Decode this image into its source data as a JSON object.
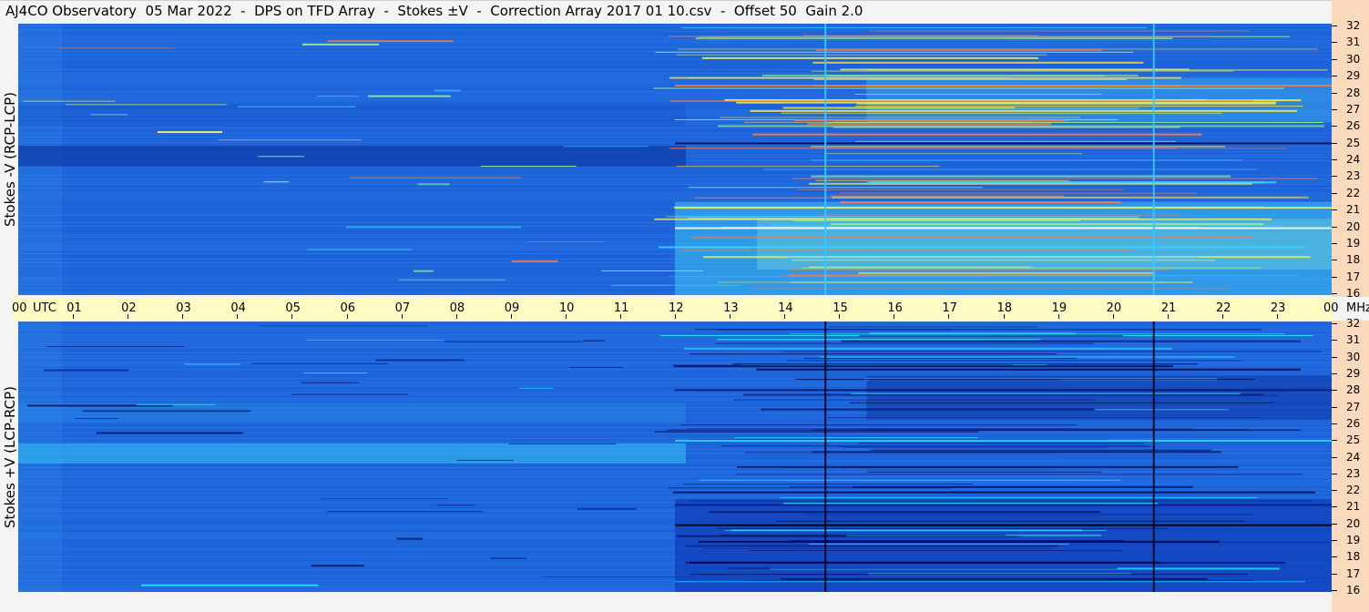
{
  "header": {
    "title": "AJ4CO Observatory  05 Mar 2022  -  DPS on TFD Array  -  Stokes ±V  -  Correction Array 2017 01 10.csv  -  Offset 50  Gain 2.0"
  },
  "chart_data": [
    {
      "type": "heatmap",
      "ylabel": "Stokes -V (RCP-LCP)",
      "xlabel": "UTC",
      "x_range_hours": [
        0,
        24
      ],
      "y_range_mhz": [
        16,
        32
      ],
      "notes": "dynamic spectrum; brighter (cyan/yellow/red) RFI and emission bands after 12 UTC, dark band near 24 MHz before 12 UTC",
      "interference_lines_utc": [
        14.75,
        20.75
      ]
    },
    {
      "type": "heatmap",
      "ylabel": "Stokes +V (LCP-RCP)",
      "xlabel": "UTC",
      "x_range_hours": [
        0,
        24
      ],
      "y_range_mhz": [
        16,
        32
      ],
      "notes": "inverse polarity; darker bands after 12 UTC, brighter band near 24 MHz before 12 UTC",
      "interference_lines_utc": [
        14.75,
        20.75
      ]
    }
  ],
  "axes": {
    "utc_labels": [
      "00",
      "UTC",
      "01",
      "02",
      "03",
      "04",
      "05",
      "06",
      "07",
      "08",
      "09",
      "10",
      "11",
      "12",
      "13",
      "14",
      "15",
      "16",
      "17",
      "18",
      "19",
      "20",
      "21",
      "22",
      "23",
      "00"
    ],
    "mhz_unit": "MHz",
    "mhz_ticks": [
      "32",
      "31",
      "30",
      "29",
      "28",
      "27",
      "26",
      "25",
      "24",
      "23",
      "22",
      "21",
      "20",
      "19",
      "18",
      "17",
      "16"
    ]
  },
  "colors": {
    "background_blue": "#1e6fe0",
    "dark_blue": "#0a2a9a",
    "cyan": "#35d2ff",
    "yellow": "#f0f060",
    "orange": "#ff7a3a",
    "timebar": "#fefcc2",
    "freq_strip": "#fbd9bd"
  }
}
